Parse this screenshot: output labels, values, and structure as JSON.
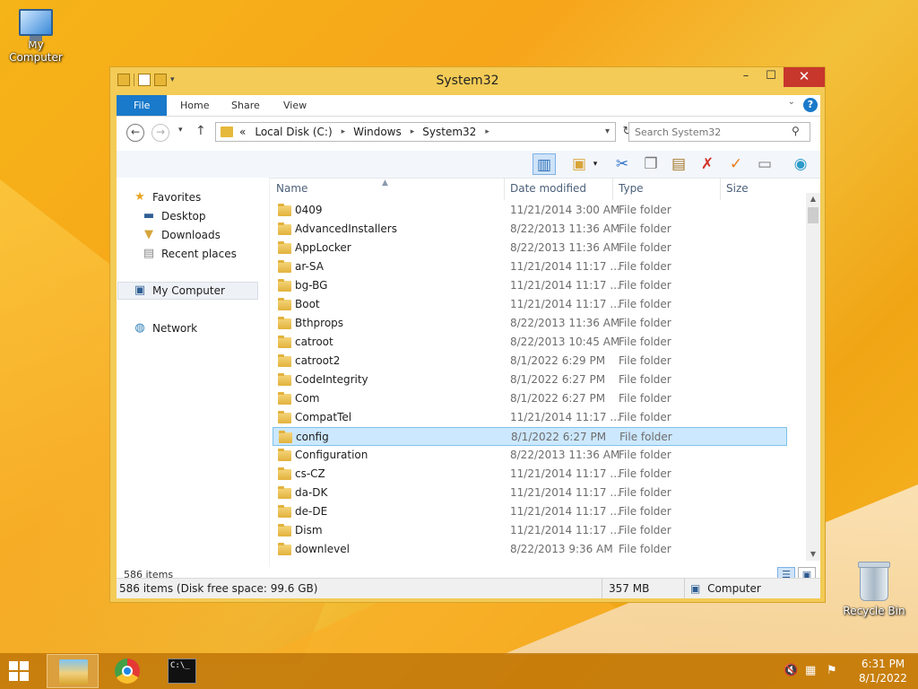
{
  "desktop": {
    "my_computer_label": "My Computer",
    "recycle_bin_label": "Recycle Bin"
  },
  "window": {
    "title": "System32",
    "controls": {
      "minimize": "–",
      "maximize": "☐",
      "close": "✕"
    }
  },
  "ribbon": {
    "tabs": [
      "File",
      "Home",
      "Share",
      "View"
    ],
    "help": "?"
  },
  "address_bar": {
    "overflow": "«",
    "crumbs": [
      "Local Disk (C:)",
      "Windows",
      "System32"
    ],
    "search_placeholder": "Search System32"
  },
  "nav_pane": {
    "favorites": "Favorites",
    "desktop": "Desktop",
    "downloads": "Downloads",
    "recent": "Recent places",
    "my_computer": "My Computer",
    "network": "Network"
  },
  "columns": {
    "name": "Name",
    "date": "Date modified",
    "type": "Type",
    "size": "Size"
  },
  "files": [
    {
      "name": "0409",
      "date": "11/21/2014 3:00 AM",
      "type": "File folder"
    },
    {
      "name": "AdvancedInstallers",
      "date": "8/22/2013 11:36 AM",
      "type": "File folder"
    },
    {
      "name": "AppLocker",
      "date": "8/22/2013 11:36 AM",
      "type": "File folder"
    },
    {
      "name": "ar-SA",
      "date": "11/21/2014 11:17 ...",
      "type": "File folder"
    },
    {
      "name": "bg-BG",
      "date": "11/21/2014 11:17 ...",
      "type": "File folder"
    },
    {
      "name": "Boot",
      "date": "11/21/2014 11:17 ...",
      "type": "File folder"
    },
    {
      "name": "Bthprops",
      "date": "8/22/2013 11:36 AM",
      "type": "File folder"
    },
    {
      "name": "catroot",
      "date": "8/22/2013 10:45 AM",
      "type": "File folder"
    },
    {
      "name": "catroot2",
      "date": "8/1/2022 6:29 PM",
      "type": "File folder"
    },
    {
      "name": "CodeIntegrity",
      "date": "8/1/2022 6:27 PM",
      "type": "File folder"
    },
    {
      "name": "Com",
      "date": "8/1/2022 6:27 PM",
      "type": "File folder"
    },
    {
      "name": "CompatTel",
      "date": "11/21/2014 11:17 ...",
      "type": "File folder"
    },
    {
      "name": "config",
      "date": "8/1/2022 6:27 PM",
      "type": "File folder",
      "selected": true
    },
    {
      "name": "Configuration",
      "date": "8/22/2013 11:36 AM",
      "type": "File folder"
    },
    {
      "name": "cs-CZ",
      "date": "11/21/2014 11:17 ...",
      "type": "File folder"
    },
    {
      "name": "da-DK",
      "date": "11/21/2014 11:17 ...",
      "type": "File folder"
    },
    {
      "name": "de-DE",
      "date": "11/21/2014 11:17 ...",
      "type": "File folder"
    },
    {
      "name": "Dism",
      "date": "11/21/2014 11:17 ...",
      "type": "File folder"
    },
    {
      "name": "downlevel",
      "date": "8/22/2013 9:36 AM",
      "type": "File folder"
    }
  ],
  "status": {
    "item_count": "586 items",
    "disk_info": "586 items (Disk free space: 99.6 GB)",
    "size": "357 MB",
    "location": "Computer"
  },
  "taskbar": {
    "time": "6:31 PM",
    "date": "8/1/2022",
    "cmd_text": "C:\\_"
  },
  "colors": {
    "title_bar": "#f3cb56",
    "file_tab": "#1979ca",
    "selection": "#cce8ff",
    "close_button": "#c7372c"
  }
}
